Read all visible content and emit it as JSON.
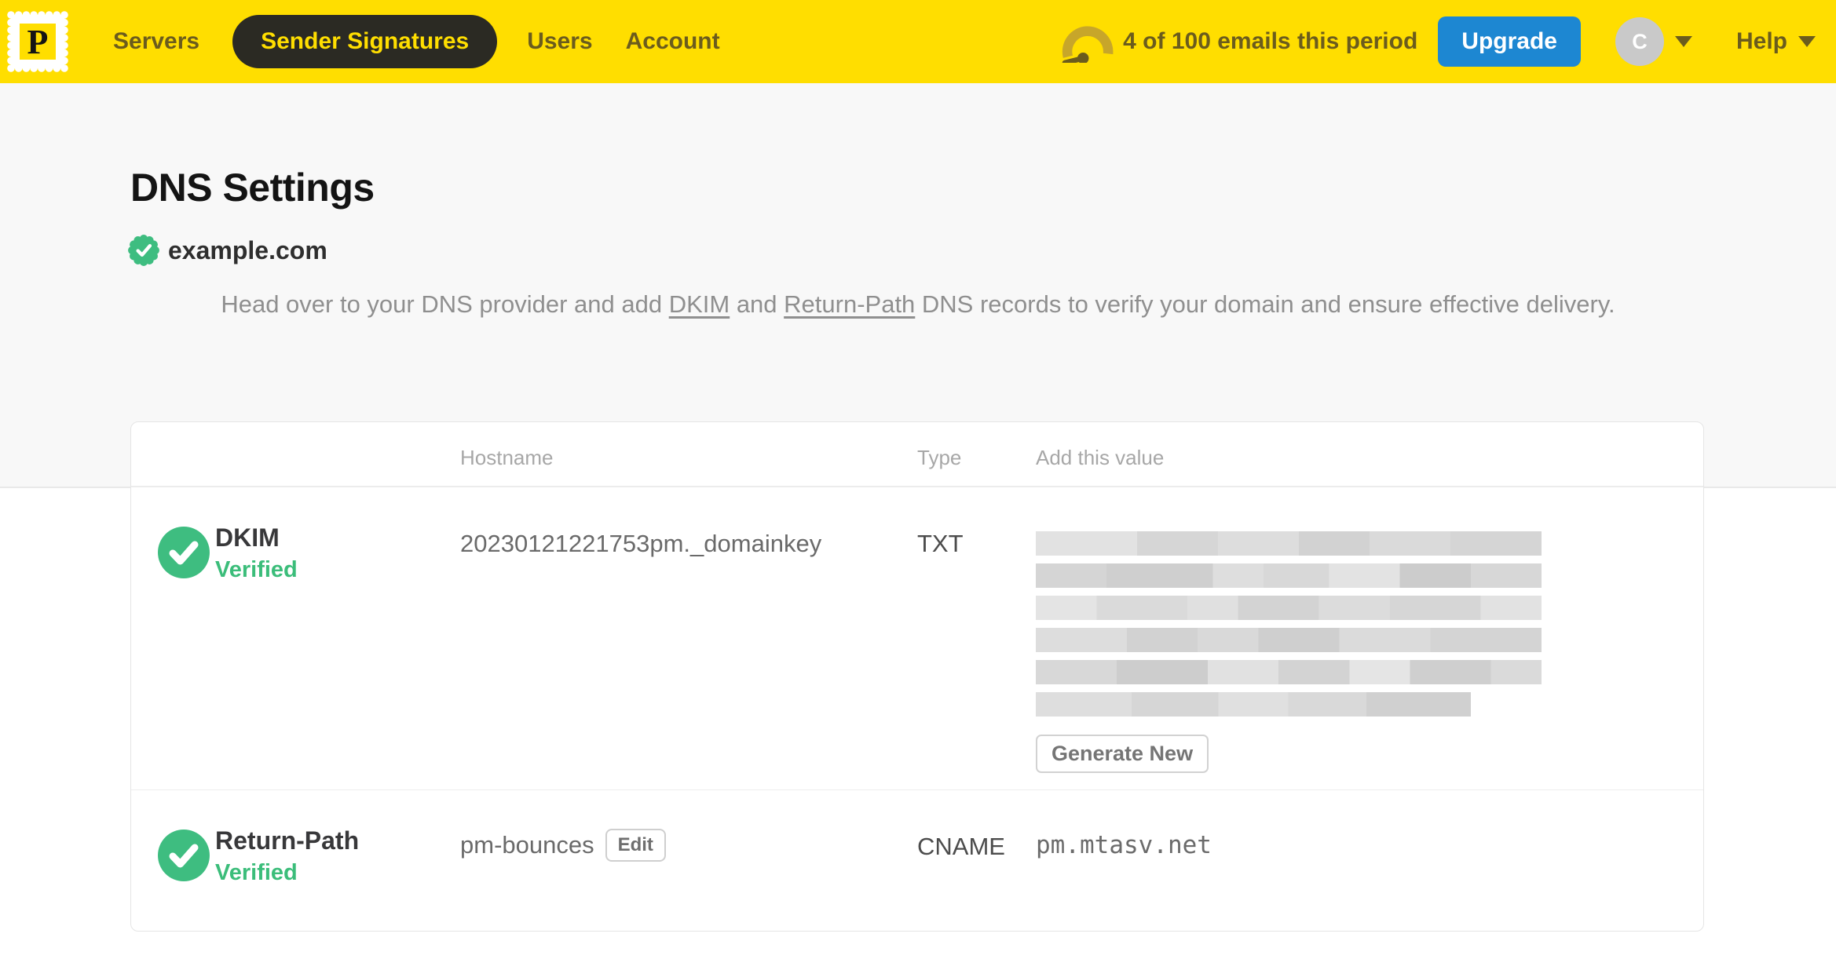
{
  "nav": {
    "logo_letter": "P",
    "items": [
      {
        "label": "Servers",
        "active": false
      },
      {
        "label": "Sender Signatures",
        "active": true
      },
      {
        "label": "Users",
        "active": false
      },
      {
        "label": "Account",
        "active": false
      }
    ],
    "usage_text": "4 of 100 emails this period",
    "upgrade_label": "Upgrade",
    "avatar_initial": "C",
    "help_label": "Help"
  },
  "page": {
    "title": "DNS Settings",
    "domain": "example.com",
    "intro": {
      "part1": "Head over to your DNS provider and add ",
      "link_dkim": "DKIM",
      "part2": " and ",
      "link_return_path": "Return-Path",
      "part3": " DNS records to verify your domain and ensure effective delivery."
    }
  },
  "dns_table": {
    "headers": {
      "hostname": "Hostname",
      "type": "Type",
      "add_value": "Add this value"
    },
    "rows": [
      {
        "name": "DKIM",
        "status": "Verified",
        "hostname": "20230121221753pm._domainkey",
        "type": "TXT",
        "value_redacted": true,
        "action_label": "Generate New"
      },
      {
        "name": "Return-Path",
        "status": "Verified",
        "hostname": "pm-bounces",
        "edit_label": "Edit",
        "type": "CNAME",
        "value": "pm.mtasv.net"
      }
    ]
  },
  "colors": {
    "brand_yellow": "#ffde00",
    "nav_text_olive": "#6b5c1d",
    "accent_blue": "#1d87d2",
    "success_green": "#3ebd80"
  }
}
